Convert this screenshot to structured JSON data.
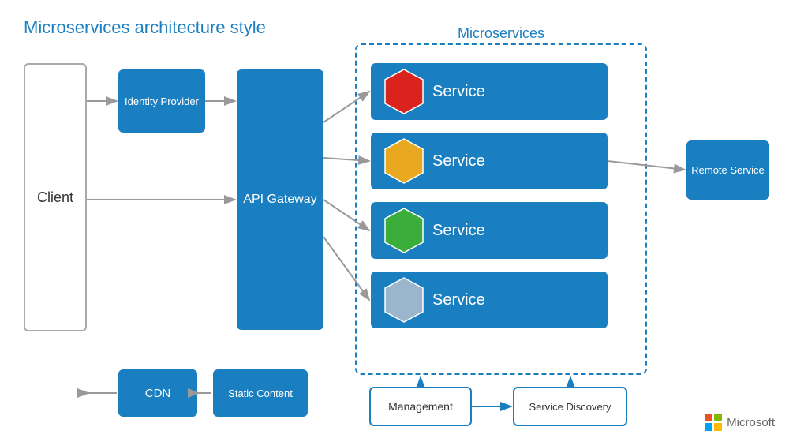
{
  "title": "Microservices architecture style",
  "microservices_label": "Microservices",
  "client_label": "Client",
  "identity_provider_label": "Identity Provider",
  "api_gateway_label": "API Gateway",
  "cdn_label": "CDN",
  "static_content_label": "Static Content",
  "remote_service_label": "Remote Service",
  "management_label": "Management",
  "service_discovery_label": "Service Discovery",
  "microsoft_label": "Microsoft",
  "services": [
    {
      "label": "Service",
      "hex_color": "#d9231c"
    },
    {
      "label": "Service",
      "hex_color": "#e8a820"
    },
    {
      "label": "Service",
      "hex_color": "#3aad3a"
    },
    {
      "label": "Service",
      "hex_color": "#9ab5cc"
    }
  ]
}
